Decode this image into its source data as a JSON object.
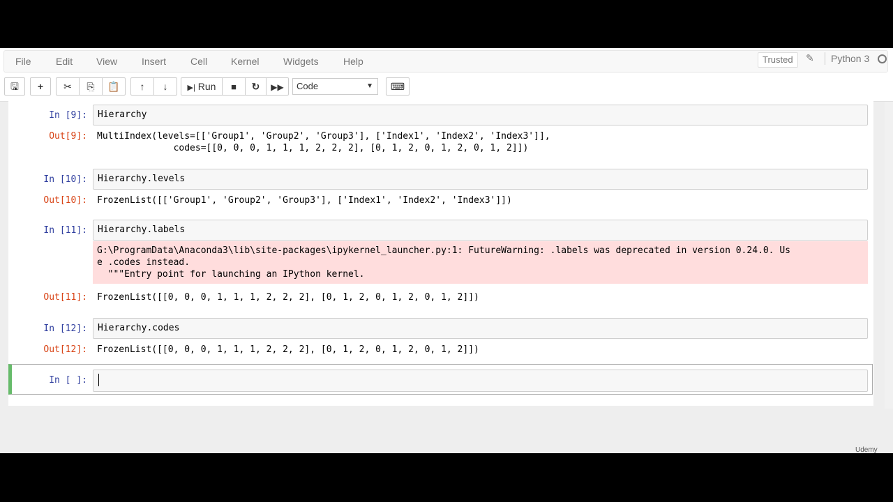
{
  "menu": {
    "items": [
      "File",
      "Edit",
      "View",
      "Insert",
      "Cell",
      "Kernel",
      "Widgets",
      "Help"
    ],
    "trusted": "Trusted",
    "kernel_name": "Python 3"
  },
  "toolbar": {
    "run_label": "Run",
    "cell_type": "Code"
  },
  "cells": [
    {
      "in_prompt": "In [9]:",
      "source": "Hierarchy",
      "out_prompt": "Out[9]:",
      "output": "MultiIndex(levels=[['Group1', 'Group2', 'Group3'], ['Index1', 'Index2', 'Index3']],\n              codes=[[0, 0, 0, 1, 1, 1, 2, 2, 2], [0, 1, 2, 0, 1, 2, 0, 1, 2]])"
    },
    {
      "in_prompt": "In [10]:",
      "source": "Hierarchy.levels",
      "out_prompt": "Out[10]:",
      "output": "FrozenList([['Group1', 'Group2', 'Group3'], ['Index1', 'Index2', 'Index3']])"
    },
    {
      "in_prompt": "In [11]:",
      "source": "Hierarchy.labels",
      "stderr": "G:\\ProgramData\\Anaconda3\\lib\\site-packages\\ipykernel_launcher.py:1: FutureWarning: .labels was deprecated in version 0.24.0. Us\ne .codes instead.\n  \"\"\"Entry point for launching an IPython kernel.",
      "out_prompt": "Out[11]:",
      "output": "FrozenList([[0, 0, 0, 1, 1, 1, 2, 2, 2], [0, 1, 2, 0, 1, 2, 0, 1, 2]])"
    },
    {
      "in_prompt": "In [12]:",
      "source": "Hierarchy.codes",
      "out_prompt": "Out[12]:",
      "output": "FrozenList([[0, 0, 0, 1, 1, 1, 2, 2, 2], [0, 1, 2, 0, 1, 2, 0, 1, 2]])"
    },
    {
      "in_prompt": "In [ ]:",
      "source": ""
    }
  ],
  "watermark": "Udemy"
}
